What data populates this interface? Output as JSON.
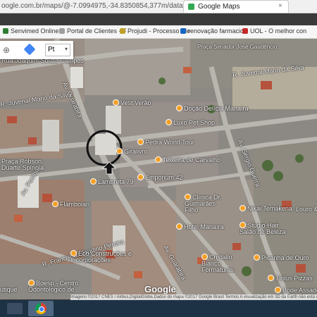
{
  "browser": {
    "url": "oogle.com.br/maps/@-7.0994975,-34.8350854,377m/data=!3m1!1e3",
    "tab_title": "Google Maps",
    "tab_close": "×"
  },
  "bookmarks": [
    {
      "label": "Senvimed Online",
      "color": "#2e7d32"
    },
    {
      "label": "Portal de Clientes - F",
      "color": "#9e9e9e"
    },
    {
      "label": "Projudi - Processo Ele",
      "color": "#bfa12a"
    },
    {
      "label": "renovação farmacio",
      "color": "#1565c0"
    },
    {
      "label": "UOL - O melhor con",
      "color": "#c62828"
    }
  ],
  "controls": {
    "zoom_symbol": "⊕",
    "language_value": "Pt",
    "dropdown_chevron": "▾"
  },
  "map_labels": {
    "street_1": "Rua Joaquim Souza Campos",
    "street_2": "Av. Guarabira",
    "street_3": "R. Juvenal Mario da Silva",
    "street_4": "R. Juvenal Mário da Silva",
    "street_5": "Av. Sérgio Guerra",
    "street_6": "R. Francisco Claudino Pereira",
    "street_7": "Av. Guarabira",
    "street_8": "Av. Pombal",
    "place_1": "Praça Senador José Gaudêncio",
    "place_2": "Vest Verão",
    "place_3": "Doção Delícia Manaíra",
    "place_4": "Luxo Pet Shop",
    "place_5": "Pedra World Tour",
    "place_6": "Giralivro",
    "place_7": "Praça Robson Duarte Spínola",
    "place_8": "Lambreta 79",
    "place_9": "Teixeira de Carvalho",
    "place_10": "Emporium 42",
    "place_11": "Flambolan",
    "place_12": "Clínica Dr. Guimarães Filho",
    "place_13": "Nikai Temakeria",
    "place_14": "Hotel Manaíra",
    "place_15": "Studio Hair Salão de Beleza",
    "place_16": "Eco Construções e Incorporações",
    "place_17": "Cristallo Bianco Formaturas",
    "place_18": "Picanha de Ouro",
    "place_19": "Boesp - Centro Odontológico de",
    "place_20": "utique",
    "place_21": "Louro &",
    "place_22": "Tiolus Pizzas",
    "place_23": "Bode Assado"
  },
  "google_logo": "Google",
  "attribution": "Imagens ©2017 CNES / Airbus,DigitalGlobe,Dados do mapa ©2017 Google    Brasil    Termos    A visualização em 3D da Earth não está disponível"
}
